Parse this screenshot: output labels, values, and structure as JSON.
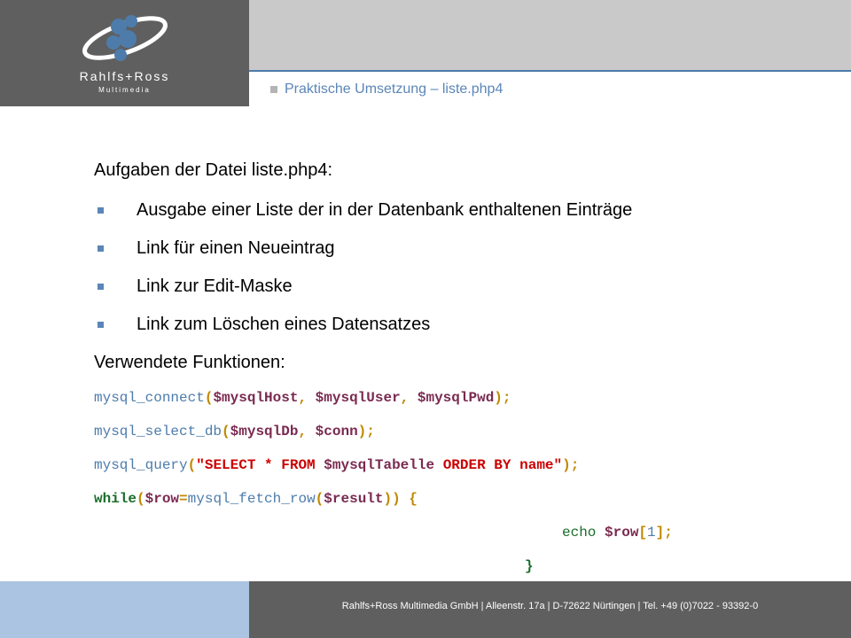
{
  "logo": {
    "name": "Rahlfs+Ross",
    "subtitle": "Multimedia"
  },
  "header": {
    "breadcrumb": "Praktische Umsetzung – liste.php4"
  },
  "content": {
    "heading1": "Aufgaben der Datei liste.php4:",
    "bullets": [
      "Ausgabe einer Liste der in der Datenbank enthaltenen Einträge",
      "Link für einen Neueintrag",
      "Link zur Edit-Maske",
      "Link zum Löschen eines Datensatzes"
    ],
    "heading2": "Verwendete Funktionen:",
    "code": {
      "l1_fn": "mysql_connect",
      "l1_a": "$mysqlHost",
      "l1_b": "$mysqlUser",
      "l1_c": "$mysqlPwd",
      "l2_fn": "mysql_select_db",
      "l2_a": "$mysqlDb",
      "l2_b": "$conn",
      "l3_fn": "mysql_query",
      "l3_s1": "\"SELECT * FROM ",
      "l3_var": "$mysqlTabelle",
      "l3_s2": " ORDER BY name\"",
      "l4_kw": "while",
      "l4_var": "$row",
      "l4_fn": "mysql_fetch_row",
      "l4_arg": "$result",
      "l5_echo": "echo",
      "l5_var": "$row",
      "l5_idx": "1",
      "l6": "}"
    }
  },
  "footer": {
    "text": "Rahlfs+Ross Multimedia GmbH | Alleenstr. 17a | D-72622 Nürtingen | Tel. +49 (0)7022 - 93392-0"
  },
  "colors": {
    "header_gray": "#c9c9c9",
    "logo_gray": "#5f5f5f",
    "accent_blue": "#4d7cab",
    "footer_blue": "#aac4e2"
  }
}
